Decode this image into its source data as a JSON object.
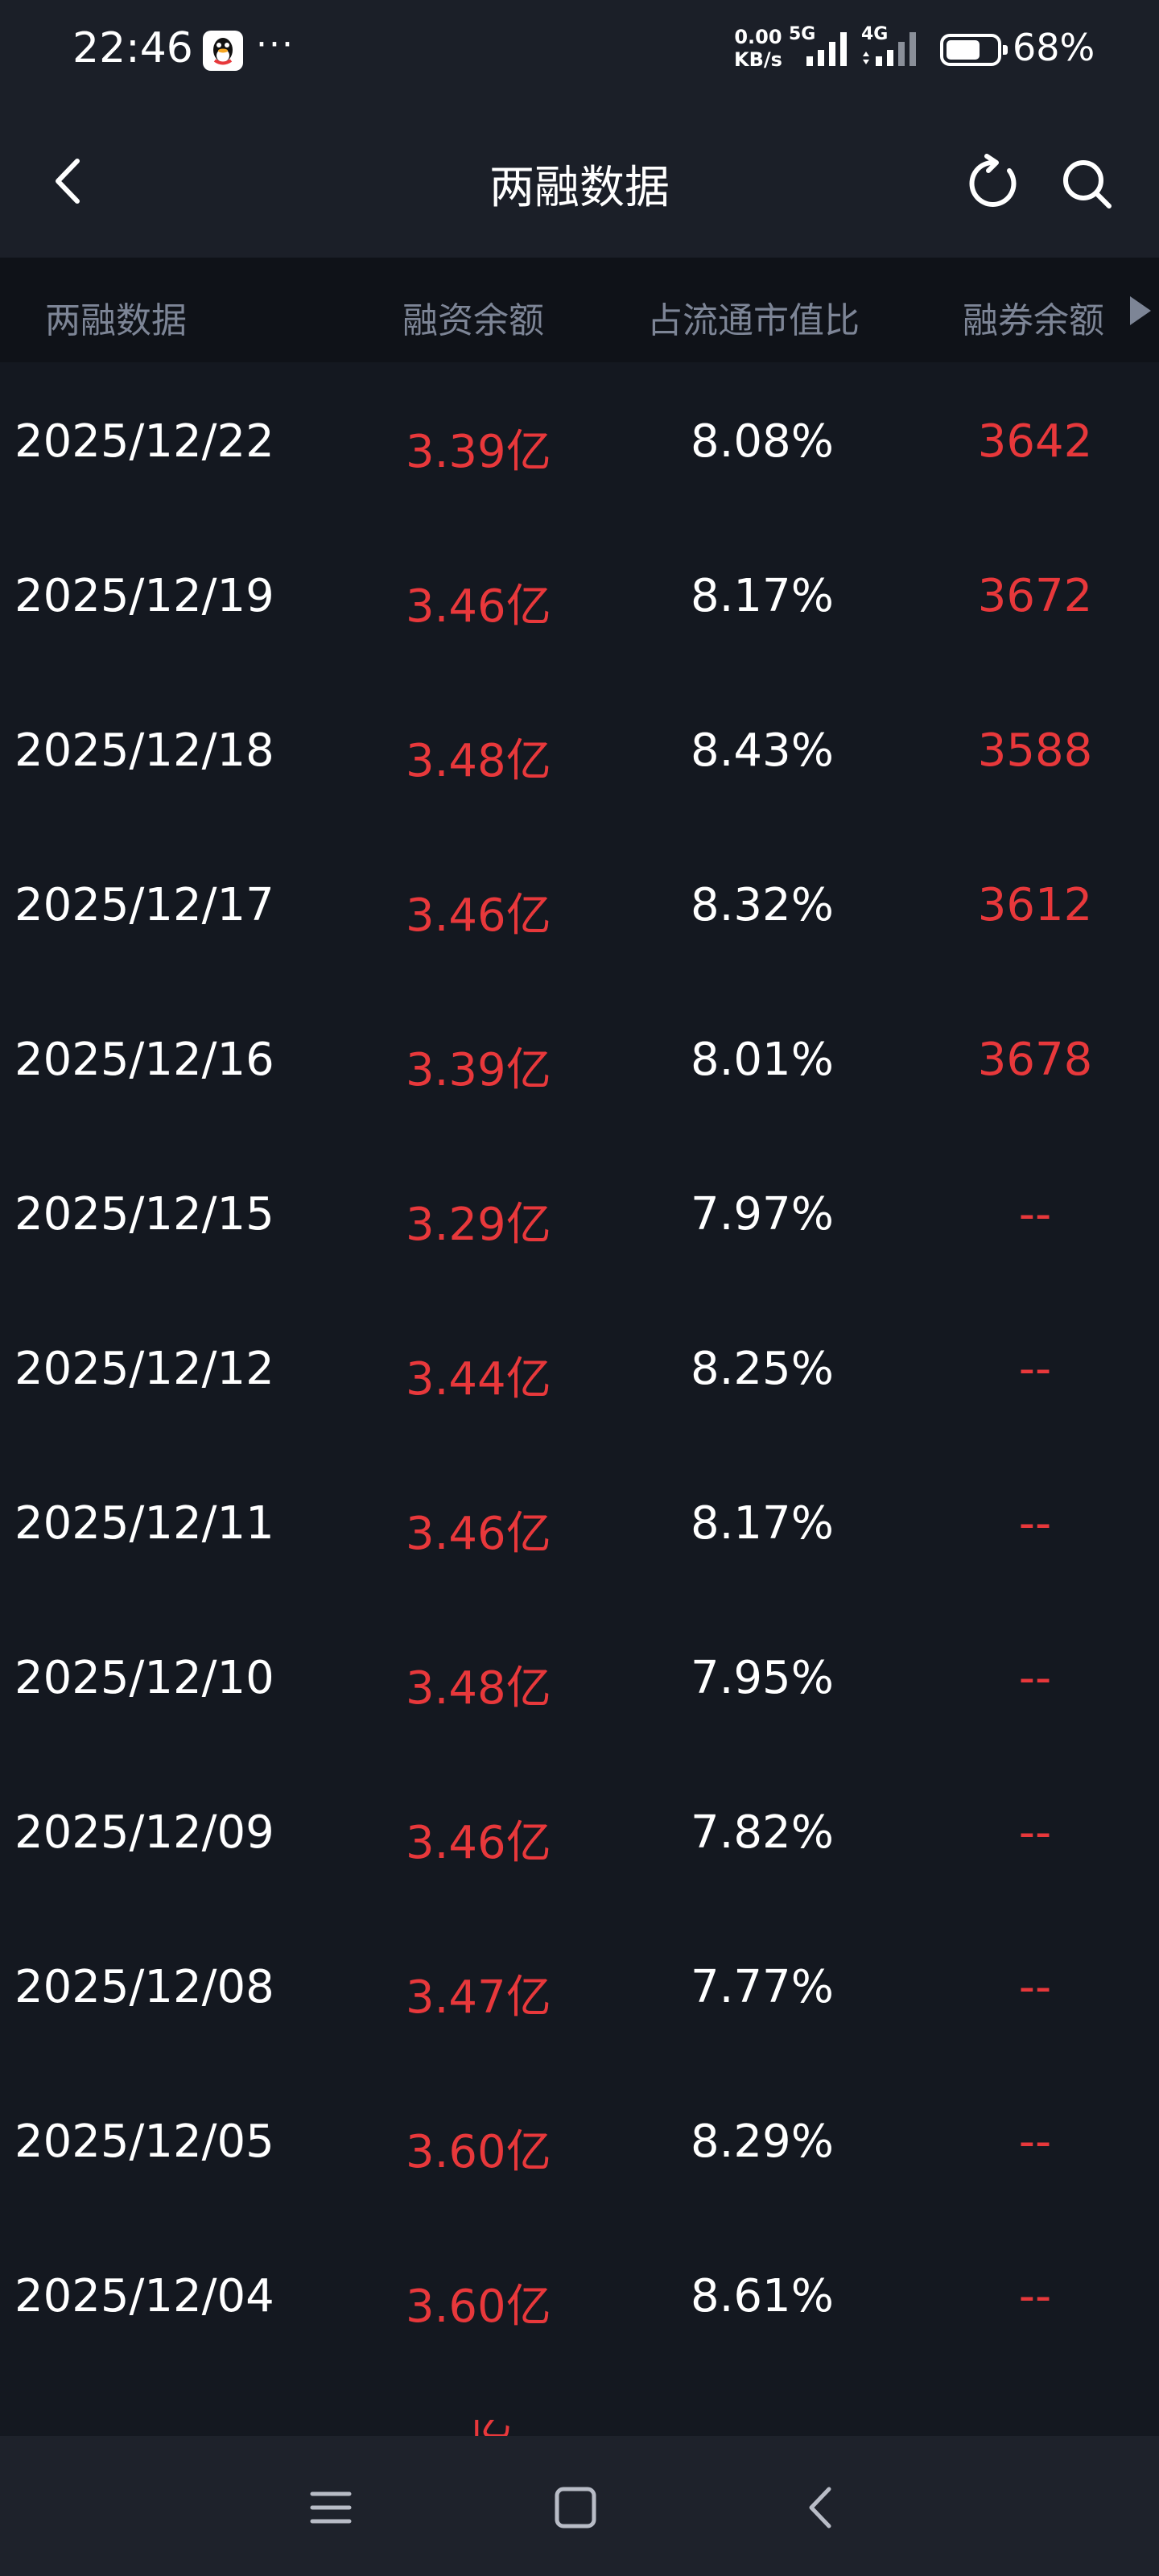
{
  "status_bar": {
    "time": "22:46",
    "dots": "···",
    "net_speed_value": "0.00",
    "net_speed_unit": "KB/s",
    "net_5g": "5G",
    "net_4g": "4G",
    "battery_level": 0.68,
    "battery_pct": "68%",
    "icons": [
      "qq-icon",
      "signal-5g-icon",
      "signal-4g-icon",
      "battery-icon"
    ]
  },
  "nav": {
    "title": "两融数据",
    "icons": [
      "back-icon",
      "refresh-icon",
      "search-icon"
    ]
  },
  "table": {
    "headers": {
      "date": "两融数据",
      "balance": "融资余额",
      "ratio": "占流通市值比",
      "short": "融券余额"
    },
    "rows": [
      {
        "date": "2025/12/22",
        "balance": "3.39亿",
        "ratio": "8.08%",
        "short": "3642"
      },
      {
        "date": "2025/12/19",
        "balance": "3.46亿",
        "ratio": "8.17%",
        "short": "3672"
      },
      {
        "date": "2025/12/18",
        "balance": "3.48亿",
        "ratio": "8.43%",
        "short": "3588"
      },
      {
        "date": "2025/12/17",
        "balance": "3.46亿",
        "ratio": "8.32%",
        "short": "3612"
      },
      {
        "date": "2025/12/16",
        "balance": "3.39亿",
        "ratio": "8.01%",
        "short": "3678"
      },
      {
        "date": "2025/12/15",
        "balance": "3.29亿",
        "ratio": "7.97%",
        "short": "--"
      },
      {
        "date": "2025/12/12",
        "balance": "3.44亿",
        "ratio": "8.25%",
        "short": "--"
      },
      {
        "date": "2025/12/11",
        "balance": "3.46亿",
        "ratio": "8.17%",
        "short": "--"
      },
      {
        "date": "2025/12/10",
        "balance": "3.48亿",
        "ratio": "7.95%",
        "short": "--"
      },
      {
        "date": "2025/12/09",
        "balance": "3.46亿",
        "ratio": "7.82%",
        "short": "--"
      },
      {
        "date": "2025/12/08",
        "balance": "3.47亿",
        "ratio": "7.77%",
        "short": "--"
      },
      {
        "date": "2025/12/05",
        "balance": "3.60亿",
        "ratio": "8.29%",
        "short": "--"
      },
      {
        "date": "2025/12/04",
        "balance": "3.60亿",
        "ratio": "8.61%",
        "short": "--"
      }
    ],
    "partial_next": "亿"
  },
  "colors": {
    "background": "#141820",
    "header_bg": "#0f1218",
    "bar_bg": "#1b1f28",
    "red": "#e8383b",
    "muted": "#7d8596",
    "white": "#ffffff"
  },
  "system_nav": {
    "icons": [
      "menu-icon",
      "home-icon",
      "back-nav-icon"
    ]
  }
}
